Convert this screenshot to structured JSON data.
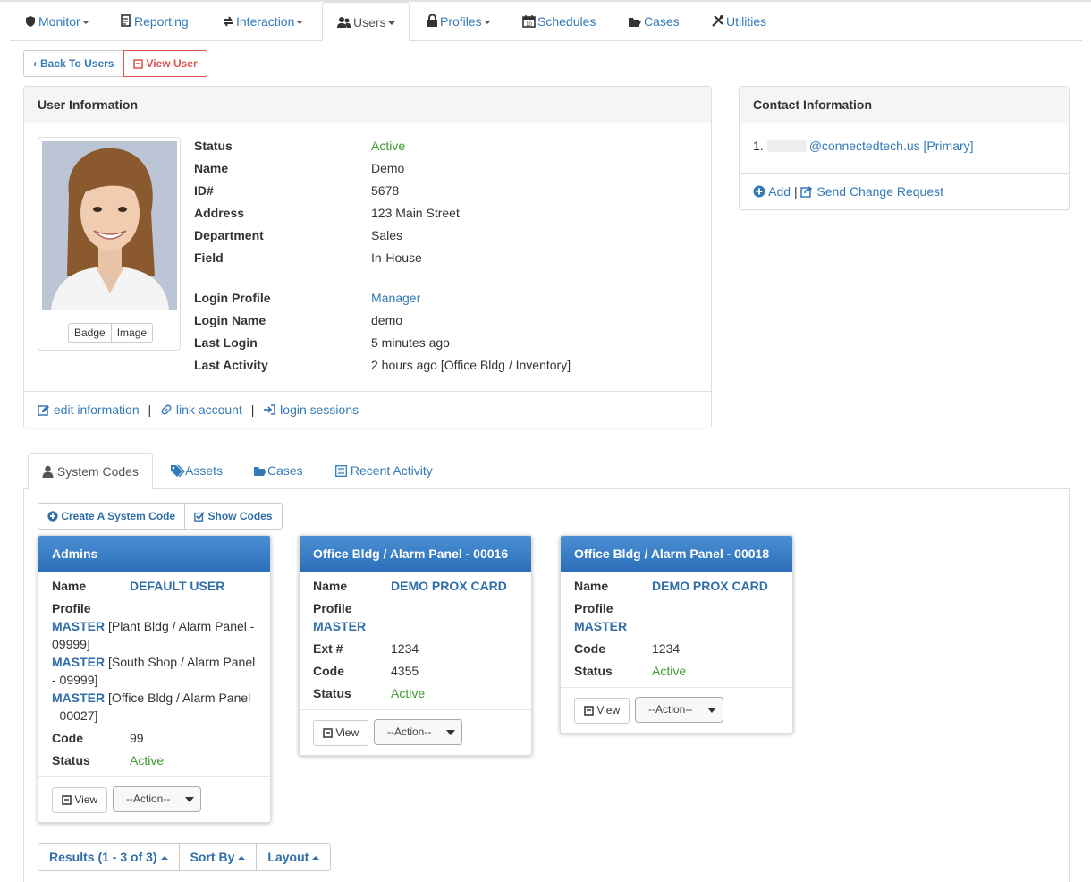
{
  "nav": {
    "monitor": "Monitor",
    "reporting": "Reporting",
    "interaction": "Interaction",
    "users": "Users",
    "profiles": "Profiles",
    "schedules": "Schedules",
    "cases": "Cases",
    "utilities": "Utilities"
  },
  "actions": {
    "back": "Back To Users",
    "view_user": "View User"
  },
  "user_panel": {
    "title": "User Information",
    "photo_buttons": [
      "Badge",
      "Image"
    ],
    "fields": [
      {
        "label": "Status",
        "value": "Active"
      },
      {
        "label": "Name",
        "value": "Demo"
      },
      {
        "label": "ID#",
        "value": "5678"
      },
      {
        "label": "Address",
        "value": "123 Main Street"
      },
      {
        "label": "Department",
        "value": "Sales"
      },
      {
        "label": "Field",
        "value": "In-House"
      },
      {
        "label": "Login Profile",
        "value": "Manager"
      },
      {
        "label": "Login Name",
        "value": "demo"
      },
      {
        "label": "Last Login",
        "value": "5 minutes ago"
      },
      {
        "label": "Last Activity",
        "value": "2 hours ago [Office Bldg / Inventory]"
      }
    ],
    "footer": {
      "edit": "edit information",
      "sep": "|",
      "link": "link account",
      "sessions": "login sessions"
    }
  },
  "contact_panel": {
    "title": "Contact Information",
    "index": "1.",
    "email": "@connectedtech.us [Primary]",
    "add": "Add",
    "sep": "|",
    "request": "Send Change Request"
  },
  "tabs": [
    "System Codes",
    "Assets",
    "Cases",
    "Recent Activity"
  ],
  "code_actions": {
    "create": "Create A System Code",
    "show": "Show Codes"
  },
  "cards": [
    {
      "title": "Admins",
      "name_label": "Name",
      "name": "DEFAULT USER",
      "profile_label": "Profile",
      "profiles": [
        {
          "master": "MASTER",
          "text": "[Plant Bldg / Alarm Panel -",
          "cont": "09999]"
        },
        {
          "master": "MASTER",
          "text": "[South Shop / Alarm Panel",
          "cont": "- 09999]"
        },
        {
          "master": "MASTER",
          "text": "[Office Bldg / Alarm Panel",
          "cont": "- 00027]"
        }
      ],
      "code_label": "Code",
      "code": "99",
      "status_label": "Status",
      "status": "Active",
      "view": "View",
      "action": "--Action--"
    },
    {
      "title": "Office Bldg / Alarm Panel - 00016",
      "name_label": "Name",
      "name": "DEMO PROX CARD",
      "profile_label": "Profile",
      "master": "MASTER",
      "ext_label": "Ext #",
      "ext": "1234",
      "code_label": "Code",
      "code": "4355",
      "status_label": "Status",
      "status": "Active",
      "view": "View",
      "action": "--Action--"
    },
    {
      "title": "Office Bldg / Alarm Panel - 00018",
      "name_label": "Name",
      "name": "DEMO PROX CARD",
      "profile_label": "Profile",
      "master": "MASTER",
      "code_label": "Code",
      "code": "1234",
      "status_label": "Status",
      "status": "Active",
      "view": "View",
      "action": "--Action--"
    }
  ],
  "bottom": {
    "results": "Results (1 - 3 of 3)",
    "sort": "Sort By",
    "layout": "Layout"
  },
  "colors": {
    "link": "#337ab7",
    "active_status": "#3c9a2e",
    "danger": "#d9534f",
    "card_header": "#3a80c8"
  }
}
